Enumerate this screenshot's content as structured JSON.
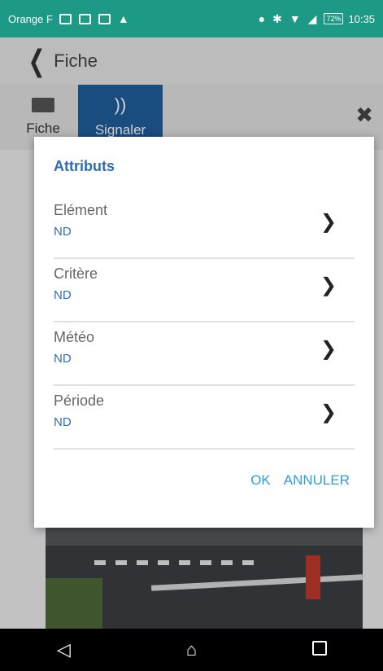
{
  "status_bar": {
    "carrier": "Orange F",
    "battery": "72%",
    "time": "10:35"
  },
  "header": {
    "title": "Fiche"
  },
  "tabs": [
    {
      "label": "Fiche",
      "icon": "id-card-icon"
    },
    {
      "label": "Signaler",
      "icon": "signal-icon"
    }
  ],
  "dialog": {
    "title": "Attributs",
    "rows": [
      {
        "label": "Elément",
        "value": "ND"
      },
      {
        "label": "Critère",
        "value": "ND"
      },
      {
        "label": "Météo",
        "value": "ND"
      },
      {
        "label": "Période",
        "value": "ND"
      }
    ],
    "ok_label": "OK",
    "cancel_label": "ANNULER"
  },
  "colors": {
    "status_bar": "#1c9a86",
    "accent_blue": "#2e6db0",
    "action_blue": "#2e9fd6",
    "tab_active": "#1f5d9c"
  }
}
